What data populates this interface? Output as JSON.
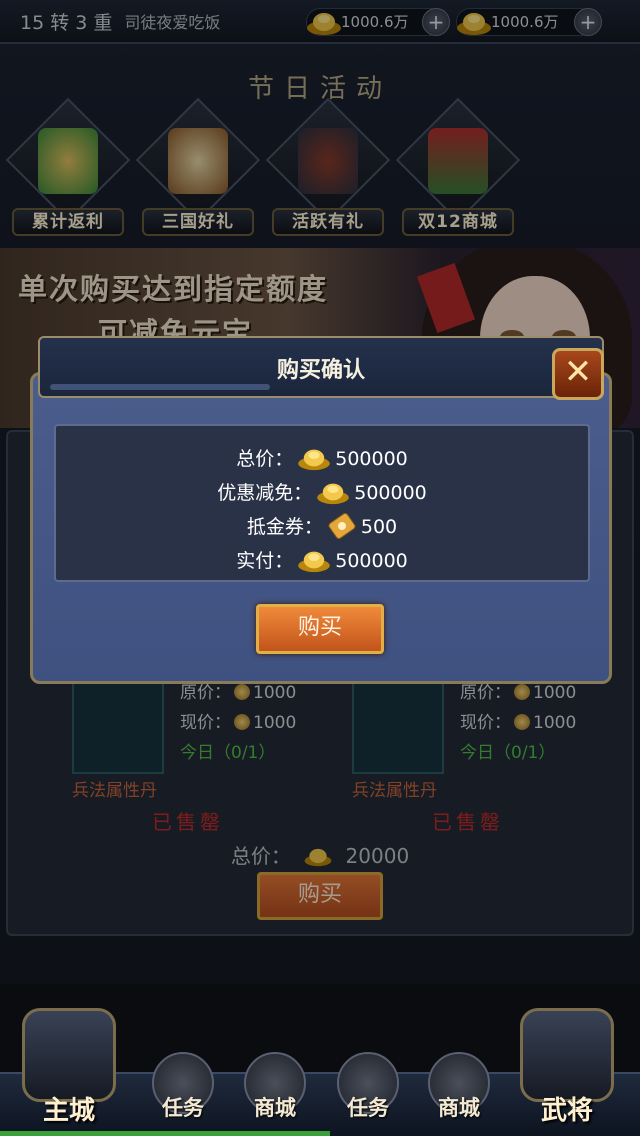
{
  "topbar": {
    "level": "15 转 3 重",
    "player_name": "司徒夜爱吃饭",
    "currency1": "1000.6万",
    "currency2": "1000.6万"
  },
  "festival": {
    "title": "节日活动",
    "activities": [
      {
        "label": "累计返利",
        "icon": "gift-bag-icon"
      },
      {
        "label": "三国好礼",
        "icon": "treasure-chest-icon"
      },
      {
        "label": "活跃有礼",
        "icon": "coin-pouch-icon"
      },
      {
        "label": "双12商城",
        "icon": "shop-gate-icon"
      }
    ]
  },
  "banner": {
    "line1": "单次购买达到指定额度",
    "line2": "可减免元宝"
  },
  "shop": {
    "cards": [
      {
        "orig_label": "原价：",
        "orig": "1000",
        "now_label": "现价：",
        "now": "1000",
        "today": "今日（0/1）",
        "name": "兵法属性丹",
        "status": "已售罄"
      },
      {
        "orig_label": "原价：",
        "orig": "1000",
        "now_label": "现价：",
        "now": "1000",
        "today": "今日（0/1）",
        "name": "兵法属性丹",
        "status": "已售罄"
      }
    ],
    "total_label": "总价：",
    "total_value": "20000",
    "buy_label": "购买"
  },
  "dialog": {
    "title": "购买确认",
    "total_label": "总价：",
    "total_value": "500000",
    "discount_label": "优惠减免：",
    "discount_value": "500000",
    "voucher_label": "抵金券：",
    "voucher_value": "500",
    "pay_label": "实付：",
    "pay_value": "500000",
    "buy_label": "购买"
  },
  "nav": {
    "main_city": "主城",
    "task1": "任务",
    "shop1": "商城",
    "task2": "任务",
    "shop2": "商城",
    "generals": "武将"
  }
}
